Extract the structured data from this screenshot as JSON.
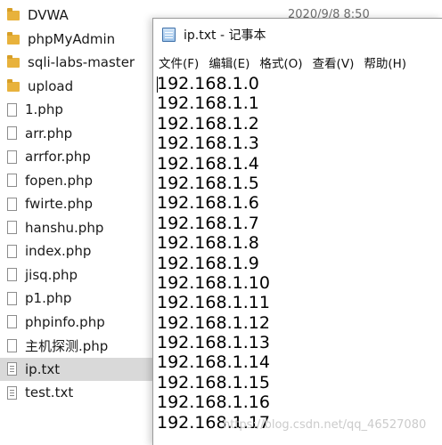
{
  "explorer": {
    "timestamp": "2020/9/8 8:50",
    "items": [
      {
        "name": "DVWA",
        "type": "folder"
      },
      {
        "name": "phpMyAdmin",
        "type": "folder"
      },
      {
        "name": "sqli-labs-master",
        "type": "folder"
      },
      {
        "name": "upload",
        "type": "folder"
      },
      {
        "name": "1.php",
        "type": "file"
      },
      {
        "name": "arr.php",
        "type": "file"
      },
      {
        "name": "arrfor.php",
        "type": "file"
      },
      {
        "name": "fopen.php",
        "type": "file"
      },
      {
        "name": "fwirte.php",
        "type": "file"
      },
      {
        "name": "hanshu.php",
        "type": "file"
      },
      {
        "name": "index.php",
        "type": "file"
      },
      {
        "name": "jisq.php",
        "type": "file"
      },
      {
        "name": "p1.php",
        "type": "file"
      },
      {
        "name": "phpinfo.php",
        "type": "file"
      },
      {
        "name": "主机探测.php",
        "type": "file"
      },
      {
        "name": "ip.txt",
        "type": "text",
        "selected": true
      },
      {
        "name": "test.txt",
        "type": "text"
      }
    ]
  },
  "notepad": {
    "title": "ip.txt - 记事本",
    "menu": [
      "文件(F)",
      "编辑(E)",
      "格式(O)",
      "查看(V)",
      "帮助(H)"
    ],
    "lines": [
      "192.168.1.0",
      "192.168.1.1",
      "192.168.1.2",
      "192.168.1.3",
      "192.168.1.4",
      "192.168.1.5",
      "192.168.1.6",
      "192.168.1.7",
      "192.168.1.8",
      "192.168.1.9",
      "192.168.1.10",
      "192.168.1.11",
      "192.168.1.12",
      "192.168.1.13",
      "192.168.1.14",
      "192.168.1.15",
      "192.168.1.16",
      "192.168.1.17"
    ]
  },
  "watermark": "https://blog.csdn.net/qq_46527080",
  "colors": {
    "folder": "#e8b23c",
    "selection": "#d9d9d9"
  }
}
